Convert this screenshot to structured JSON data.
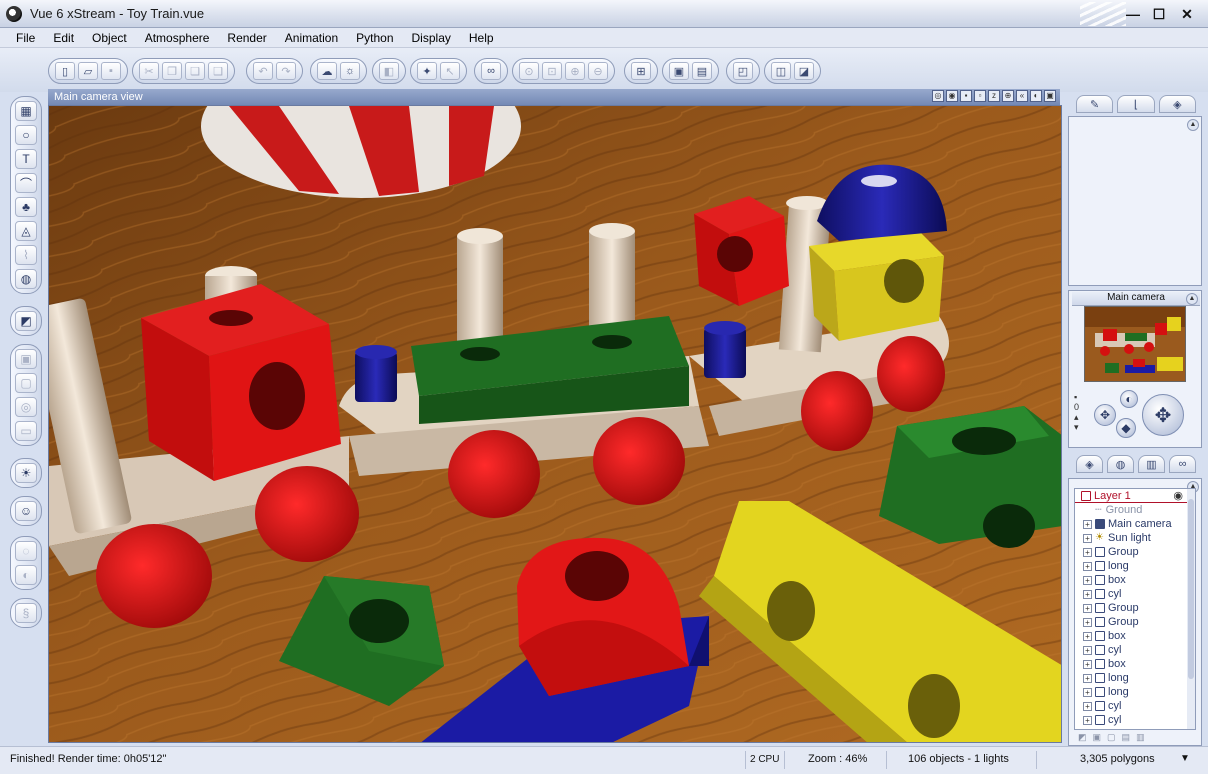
{
  "window": {
    "title": "Vue 6 xStream - Toy Train.vue",
    "minimize": "—",
    "maximize": "☐",
    "close": "✕"
  },
  "menu": [
    "File",
    "Edit",
    "Object",
    "Atmosphere",
    "Render",
    "Animation",
    "Python",
    "Display",
    "Help"
  ],
  "viewport": {
    "title": "Main camera view"
  },
  "camera_panel": {
    "title": "Main camera"
  },
  "scene_tree": {
    "layer": "Layer 1",
    "items": [
      {
        "label": "Ground",
        "type": "ground"
      },
      {
        "label": "Main camera",
        "type": "camera"
      },
      {
        "label": "Sun light",
        "type": "light"
      },
      {
        "label": "Group",
        "type": "object"
      },
      {
        "label": "long",
        "type": "object"
      },
      {
        "label": "box",
        "type": "object"
      },
      {
        "label": "cyl",
        "type": "object"
      },
      {
        "label": "Group",
        "type": "object"
      },
      {
        "label": "Group",
        "type": "object"
      },
      {
        "label": "box",
        "type": "object"
      },
      {
        "label": "cyl",
        "type": "object"
      },
      {
        "label": "box",
        "type": "object"
      },
      {
        "label": "long",
        "type": "object"
      },
      {
        "label": "long",
        "type": "object"
      },
      {
        "label": "cyl",
        "type": "object"
      },
      {
        "label": "cyl",
        "type": "object"
      }
    ]
  },
  "status": {
    "message": "Finished! Render time: 0h05'12\"",
    "cpu": "2 CPU",
    "zoom": "Zoom : 46%",
    "objects": "106 objects - 1 lights",
    "polygons": "3,305 polygons"
  },
  "colors": {
    "wood": "#8a4a14",
    "red": "#d40f0f",
    "green": "#1e6a1e",
    "yellow": "#e6d21e",
    "blue": "#1a1a9a",
    "peg": "#e9dccb"
  }
}
